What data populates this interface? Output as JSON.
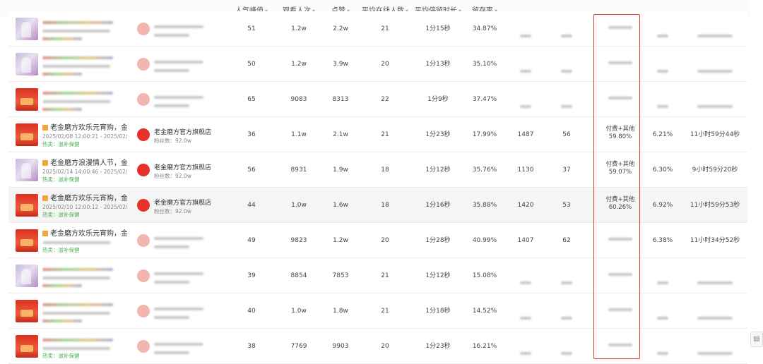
{
  "table": {
    "columns": [
      {
        "label": "人气峰值"
      },
      {
        "label": "观看人次"
      },
      {
        "label": "点赞"
      },
      {
        "label": "平均在线人数"
      },
      {
        "label": "平均停留时长"
      },
      {
        "label": "留存率"
      }
    ],
    "sort_glyph": "▾",
    "rows": [
      {
        "thumb": "purple",
        "title": "",
        "date": "",
        "hot": "",
        "shop": "",
        "fans": "",
        "peak": "51",
        "views": "1.2w",
        "likes": "2.2w",
        "avg_online": "21",
        "avg_stay": "1分15秒",
        "retention": "34.87%",
        "c1": "",
        "c2": "",
        "source": "",
        "source_pct": "",
        "ratio": "",
        "duration": ""
      },
      {
        "thumb": "purple",
        "title": "",
        "date": "",
        "hot": "",
        "shop": "",
        "fans": "",
        "peak": "50",
        "views": "1.2w",
        "likes": "3.9w",
        "avg_online": "20",
        "avg_stay": "1分13秒",
        "retention": "35.10%",
        "c1": "",
        "c2": "",
        "source": "",
        "source_pct": "",
        "ratio": "",
        "duration": ""
      },
      {
        "thumb": "red",
        "title": "",
        "date": "",
        "hot": "",
        "shop": "",
        "fans": "",
        "peak": "65",
        "views": "9083",
        "likes": "8313",
        "avg_online": "22",
        "avg_stay": "1分9秒",
        "retention": "37.47%",
        "c1": "",
        "c2": "",
        "source": "",
        "source_pct": "",
        "ratio": "",
        "duration": ""
      },
      {
        "thumb": "red",
        "title": "老金磨方欢乐元宵购，金礼...",
        "date": "2025/02/08 12:00:21 - 2025/02/08 0...",
        "hot": "热卖：滋补保健",
        "shop": "老金磨方官方旗舰店",
        "fans": "粉丝数：92.0w",
        "peak": "36",
        "views": "1.1w",
        "likes": "2.1w",
        "avg_online": "21",
        "avg_stay": "1分23秒",
        "retention": "17.99%",
        "c1": "1487",
        "c2": "56",
        "source": "付费+其他",
        "source_pct": "59.80%",
        "ratio": "6.21%",
        "duration": "11小时59分44秒"
      },
      {
        "thumb": "purple",
        "title": "老金磨方浪漫情人节，金礼...",
        "date": "2025/02/14 14:00:46 - 2025/02/15 0...",
        "hot": "热卖：滋补保健",
        "shop": "老金磨方官方旗舰店",
        "fans": "粉丝数：92.0w",
        "peak": "56",
        "views": "8931",
        "likes": "1.9w",
        "avg_online": "18",
        "avg_stay": "1分12秒",
        "retention": "35.76%",
        "c1": "1130",
        "c2": "37",
        "source": "付费+其他",
        "source_pct": "59.07%",
        "ratio": "6.30%",
        "duration": "9小时59分20秒"
      },
      {
        "thumb": "red",
        "title": "老金磨方欢乐元宵购，金礼...",
        "date": "2025/02/10 12:00:12 - 2025/02/11 00...",
        "hot": "热卖：滋补保健",
        "shop": "老金磨方官方旗舰店",
        "fans": "粉丝数：92.0w",
        "peak": "44",
        "views": "1.0w",
        "likes": "1.6w",
        "avg_online": "18",
        "avg_stay": "1分16秒",
        "retention": "35.88%",
        "c1": "1420",
        "c2": "53",
        "source": "付费+其他",
        "source_pct": "60.26%",
        "ratio": "6.92%",
        "duration": "11小时59分53秒"
      },
      {
        "thumb": "red",
        "title": "老金磨方欢乐元宵购，金礼...",
        "date": "",
        "hot": "热卖：滋补保健",
        "shop": "",
        "fans": "",
        "peak": "49",
        "views": "9823",
        "likes": "1.2w",
        "avg_online": "20",
        "avg_stay": "1分28秒",
        "retention": "40.99%",
        "c1": "1407",
        "c2": "62",
        "source": "",
        "source_pct": "",
        "ratio": "6.38%",
        "duration": "11小时34分52秒"
      },
      {
        "thumb": "purple",
        "title": "",
        "date": "",
        "hot": "",
        "shop": "",
        "fans": "",
        "peak": "39",
        "views": "8854",
        "likes": "7853",
        "avg_online": "21",
        "avg_stay": "1分12秒",
        "retention": "15.08%",
        "c1": "",
        "c2": "",
        "source": "",
        "source_pct": "",
        "ratio": "",
        "duration": ""
      },
      {
        "thumb": "red",
        "title": "",
        "date": "",
        "hot": "",
        "shop": "",
        "fans": "",
        "peak": "40",
        "views": "1.0w",
        "likes": "1.8w",
        "avg_online": "21",
        "avg_stay": "1分18秒",
        "retention": "14.52%",
        "c1": "",
        "c2": "",
        "source": "",
        "source_pct": "",
        "ratio": "",
        "duration": ""
      },
      {
        "thumb": "red",
        "title": "",
        "date": "",
        "hot": "热卖：滋补保健",
        "shop": "",
        "fans": "",
        "peak": "38",
        "views": "7769",
        "likes": "9903",
        "avg_online": "20",
        "avg_stay": "1分23秒",
        "retention": "16.21%",
        "c1": "",
        "c2": "",
        "source": "",
        "source_pct": "",
        "ratio": "",
        "duration": ""
      }
    ]
  },
  "side_button_icon": "document-icon",
  "side_button_glyph": "▤",
  "highlight_color": "#e53935"
}
